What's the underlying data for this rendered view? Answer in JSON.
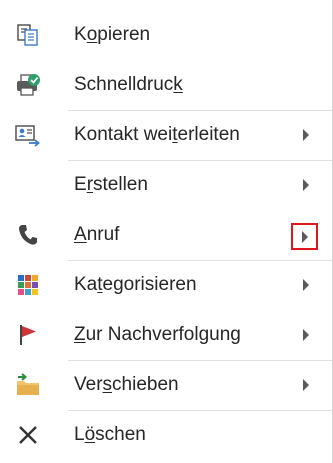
{
  "menu": {
    "items": [
      {
        "pre": "K",
        "u": "o",
        "post": "pieren",
        "icon": "copy-icon",
        "submenu": false
      },
      {
        "pre": "Schnelldruc",
        "u": "k",
        "post": "",
        "icon": "quick-print-icon",
        "submenu": false
      },
      {
        "pre": "Kontakt wei",
        "u": "t",
        "post": "erleiten",
        "icon": "forward-contact-icon",
        "submenu": true
      },
      {
        "pre": "E",
        "u": "r",
        "post": "stellen",
        "icon": "",
        "submenu": true
      },
      {
        "pre": "",
        "u": "A",
        "post": "nruf",
        "icon": "phone-icon",
        "submenu": true,
        "highlighted_arrow": true
      },
      {
        "pre": "Ka",
        "u": "t",
        "post": "egorisieren",
        "icon": "categorize-icon",
        "submenu": true
      },
      {
        "pre": "",
        "u": "Z",
        "post": "ur Nachverfolgung",
        "icon": "follow-up-flag-icon",
        "submenu": true
      },
      {
        "pre": "Ver",
        "u": "s",
        "post": "chieben",
        "icon": "move-folder-icon",
        "submenu": true
      },
      {
        "pre": "L",
        "u": "ö",
        "post": "schen",
        "icon": "delete-icon",
        "submenu": false
      }
    ]
  },
  "colors": {
    "highlight_box": "#e0161d",
    "flag": "#d13438",
    "folder": "#f2c46e",
    "arrow": "#5a5a5a",
    "phone": "#444444"
  }
}
